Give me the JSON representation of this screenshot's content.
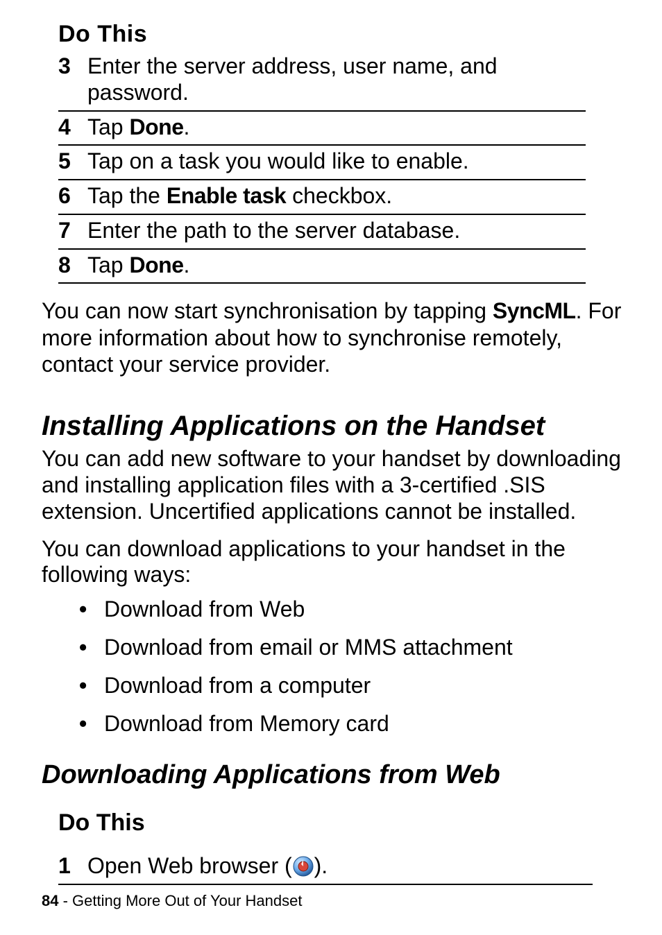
{
  "steps1": {
    "title": "Do This",
    "rows": [
      {
        "n": "3",
        "parts": [
          "Enter the server address, user name, and password."
        ]
      },
      {
        "n": "4",
        "parts": [
          "Tap ",
          {
            "cond": true,
            "t": "Done"
          },
          "."
        ]
      },
      {
        "n": "5",
        "parts": [
          "Tap on a task you would like to enable."
        ]
      },
      {
        "n": "6",
        "parts": [
          "Tap the ",
          {
            "cond": true,
            "t": "Enable task"
          },
          " checkbox."
        ]
      },
      {
        "n": "7",
        "parts": [
          "Enter the path to the server database."
        ]
      },
      {
        "n": "8",
        "parts": [
          "Tap ",
          {
            "cond": true,
            "t": "Done"
          },
          "."
        ]
      }
    ]
  },
  "para_after_steps1": {
    "parts": [
      "You can now start synchronisation by tapping ",
      {
        "cond": true,
        "t": "SyncML"
      },
      ". For more information about how to synchronise remotely, contact your service provider."
    ]
  },
  "section_heading": "Installing Applications on the Handset",
  "para_install_1": "You can add new software to your handset by downloading and installing application files with a 3-certified .SIS extension. Uncertified applications cannot be installed.",
  "para_install_2": "You can download applications to your handset in the following ways:",
  "bullets": [
    "Download from Web",
    "Download from email or MMS attachment",
    "Download from a computer",
    "Download from Memory card"
  ],
  "subsection_heading": "Downloading Applications from Web",
  "steps2": {
    "title": "Do This",
    "rows": [
      {
        "n": "1",
        "before": "Open Web browser (",
        "icon": "browser-icon",
        "after": ")."
      }
    ]
  },
  "footer": {
    "page_number": "84",
    "sep": " - ",
    "chapter": "Getting More Out of Your Handset"
  }
}
